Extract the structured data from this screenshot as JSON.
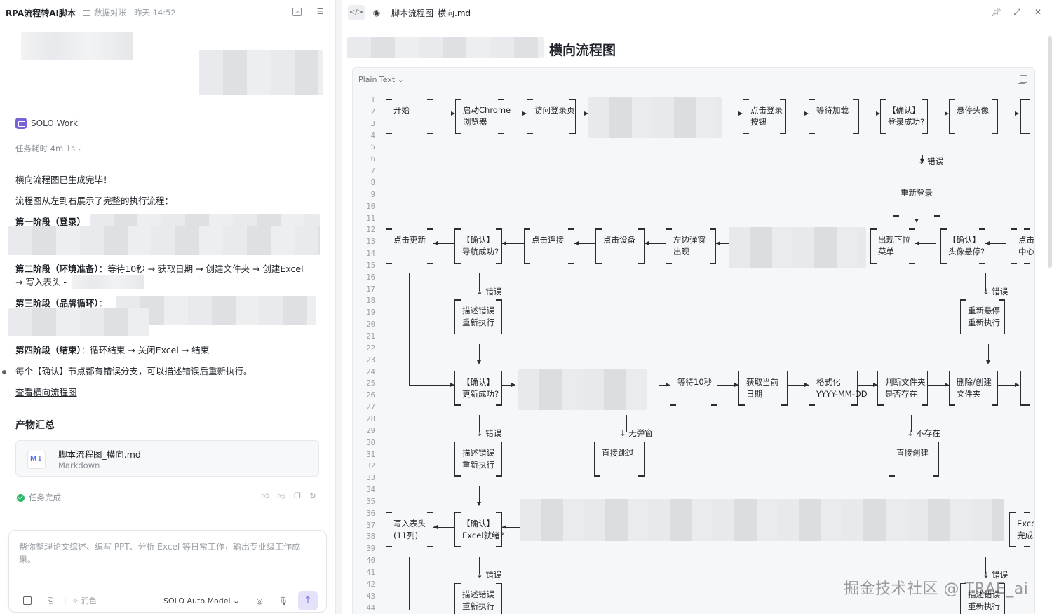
{
  "left": {
    "app_title": "RPA流程转AI脚本",
    "breadcrumb": "数据对账 · 昨天 14:52",
    "agent_name": "SOLO Work",
    "duration": "任务耗时 4m 1s",
    "messages": {
      "done": "横向流程图已生成完毕！",
      "intro": "流程图从左到右展示了完整的执行流程：",
      "phase1_title": "第一阶段（登录）",
      "phase2_title": "第二阶段（环境准备）",
      "phase2_body": "：等待10秒 → 获取日期 → 创建文件夹 → 创建Excel",
      "phase2_cont": "→ 写入表头 -",
      "phase3_title": "第三阶段（品牌循环）",
      "phase3_colon": "：",
      "phase4_title": "第四阶段（结束）",
      "phase4_body": "：循环结束 → 关闭Excel → 结束",
      "note": "每个【确认】节点都有错误分支，可以描述错误后重新执行。",
      "view_link": "查看横向流程图"
    },
    "artifacts_title": "产物汇总",
    "file": {
      "icon": "M↓",
      "name": "脚本流程图_横向.md",
      "type": "Markdown"
    },
    "status": "任务完成",
    "input": {
      "placeholder": "帮你整理论文综述、编写 PPT、分析 Excel 等日常工作，输出专业级工作成果。",
      "value": "",
      "enhance_label": "润色",
      "model": "SOLO Auto Model"
    }
  },
  "right": {
    "tab_title": "脚本流程图_横向.md",
    "heading": "横向流程图",
    "code_lang": "Plain Text",
    "flow": {
      "start": "开始",
      "launch_1": "启动Chrome",
      "launch_2": "浏览器",
      "visit": "访问登录页",
      "click_login_1": "点击登录",
      "click_login_2": "按钮",
      "wait_load": "等待加载",
      "confirm_login_1": "【确认】",
      "confirm_login_2": "登录成功?",
      "hover_avatar": "悬停头像",
      "err": "错误",
      "relogin": "重新登录",
      "click_update": "点击更新",
      "confirm_nav_1": "【确认】",
      "confirm_nav_2": "导航成功?",
      "click_connect": "点击连接",
      "click_device": "点击设备",
      "left_popup_1": "左边弹窗",
      "left_popup_2": "出现",
      "dropdown_1": "出现下拉",
      "dropdown_2": "菜单",
      "confirm_hover_1": "【确认】",
      "confirm_hover_2": "头像悬停?",
      "click_center_1": "点击",
      "click_center_2": "中心",
      "desc_err_1": "描述错误",
      "desc_err_2": "重新执行",
      "rehover_1": "重新悬停",
      "rehover_2": "重新执行",
      "confirm_update_1": "【确认】",
      "confirm_update_2": "更新成功?",
      "wait10": "等待10秒",
      "get_date_1": "获取当前",
      "get_date_2": "日期",
      "format_1": "格式化",
      "format_2": "YYYY-MM-DD",
      "check_folder_1": "判断文件夹",
      "check_folder_2": "是否存在",
      "del_create_1": "删除/创建",
      "del_create_2": "文件夹",
      "no_popup": "无弹窗",
      "not_exist": "不存在",
      "skip": "直接跳过",
      "create_direct": "直接创建",
      "write_header_1": "写入表头",
      "write_header_2": "(11列)",
      "confirm_excel_1": "【确认】",
      "confirm_excel_2": "Excel就绪?",
      "excel_1": "Exce",
      "excel_2": "完成"
    },
    "line_numbers": [
      "1",
      "2",
      "3",
      "4",
      "5",
      "6",
      "7",
      "8",
      "9",
      "10",
      "11",
      "12",
      "13",
      "14",
      "15",
      "16",
      "17",
      "18",
      "19",
      "20",
      "21",
      "22",
      "23",
      "24",
      "25",
      "26",
      "27",
      "28",
      "29",
      "30",
      "31",
      "32",
      "33",
      "34",
      "35",
      "36",
      "37",
      "38",
      "39",
      "40",
      "41",
      "42",
      "43",
      "44"
    ]
  },
  "watermark": "掘金技术社区 @ TRAE_ai"
}
